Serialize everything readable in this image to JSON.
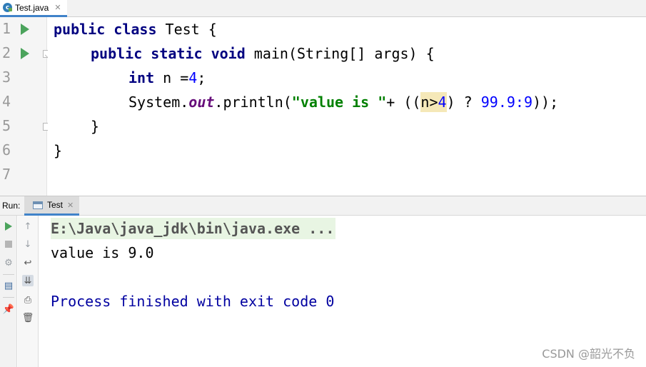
{
  "editor_tab": {
    "label": "Test.java",
    "close": "✕"
  },
  "editor": {
    "line_numbers": [
      "1",
      "2",
      "3",
      "4",
      "5",
      "6",
      "7"
    ],
    "code": {
      "l1_kw": "public class",
      "l1_rest": " Test {",
      "l2_kw": "public static void",
      "l2_rest": " main(String[] args) {",
      "l3_kw": "int",
      "l3_rest": " n =",
      "l3_num": "4",
      "l3_end": ";",
      "l4_a": "System.",
      "l4_field": "out",
      "l4_b": ".println(",
      "l4_str": "\"value is \"",
      "l4_c": "+ ((",
      "l4_hl_n": "n>",
      "l4_hl_num": "4",
      "l4_d": ") ? ",
      "l4_num1": "99.9",
      "l4_e": ":",
      "l4_num2": "9",
      "l4_f": "));",
      "l5": "}",
      "l6": "}"
    }
  },
  "run_panel": {
    "title": "Run:",
    "tab_label": "Test",
    "tab_close": "✕",
    "console": {
      "command": "E:\\Java\\java_jdk\\bin\\java.exe ...",
      "output": "value is 9.0",
      "exit": "Process finished with exit code 0"
    }
  },
  "watermark": "CSDN @韶光不负",
  "colors": {
    "keyword": "#000080",
    "string": "#008000",
    "number": "#0000ff",
    "field": "#660e7a",
    "run_green": "#4ba35c",
    "tab_accent": "#4083c9"
  }
}
